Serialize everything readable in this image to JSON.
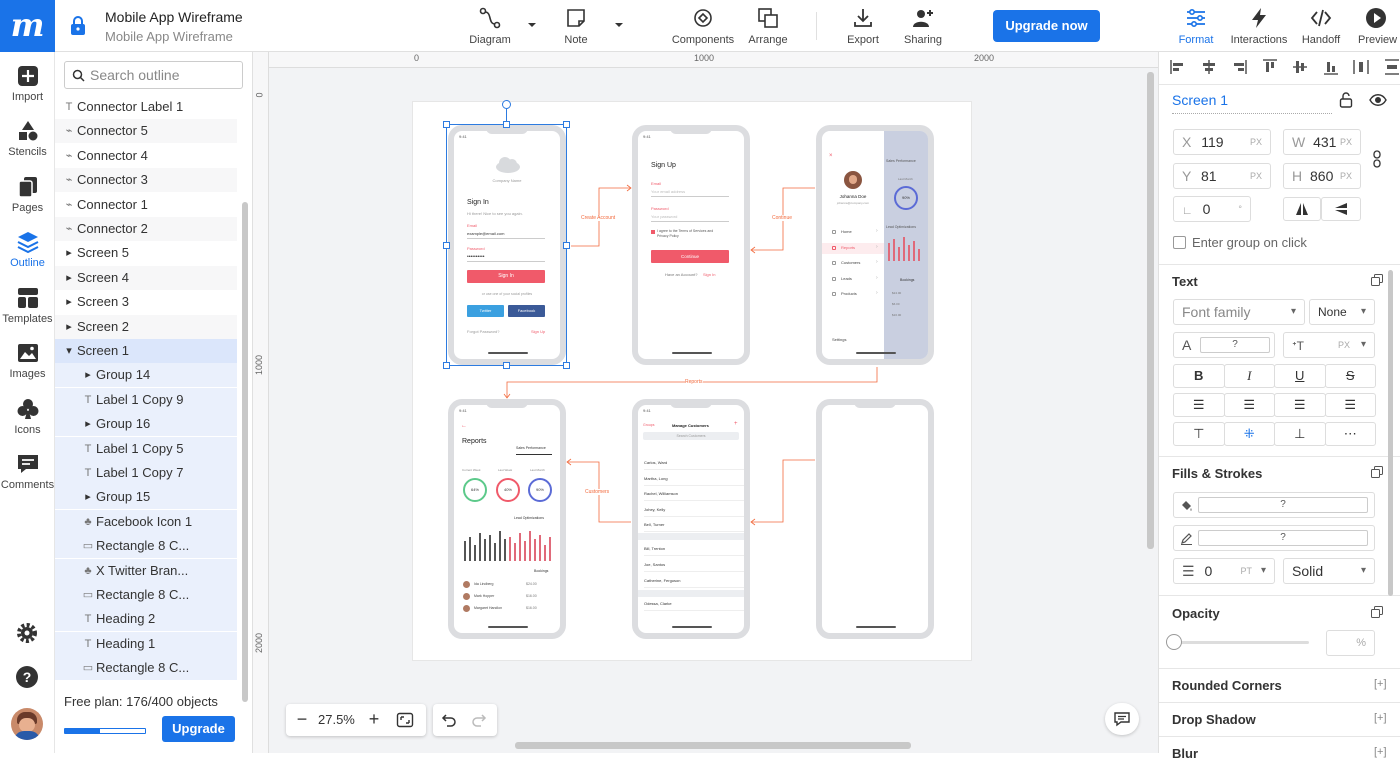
{
  "app": {
    "logo": "m",
    "title": "Mobile App Wireframe",
    "subtitle": "Mobile App Wireframe"
  },
  "toolbar": {
    "diagram": "Diagram",
    "note": "Note",
    "components": "Components",
    "arrange": "Arrange",
    "export": "Export",
    "sharing": "Sharing",
    "upgrade_now": "Upgrade now",
    "format": "Format",
    "interactions": "Interactions",
    "handoff": "Handoff",
    "preview": "Preview"
  },
  "leftrail": {
    "import": "Import",
    "stencils": "Stencils",
    "pages": "Pages",
    "outline": "Outline",
    "templates": "Templates",
    "images": "Images",
    "icons": "Icons",
    "comments": "Comments"
  },
  "outline": {
    "search_placeholder": "Search outline",
    "items": [
      {
        "label": "Connector Label 1",
        "icon": "text-icon"
      },
      {
        "label": "Connector 5",
        "icon": "connector-icon"
      },
      {
        "label": "Connector 4",
        "icon": "connector-icon"
      },
      {
        "label": "Connector 3",
        "icon": "connector-icon"
      },
      {
        "label": "Connector 1",
        "icon": "connector-icon"
      },
      {
        "label": "Connector 2",
        "icon": "connector-icon"
      },
      {
        "label": "Screen 5",
        "icon": "caret-right-icon"
      },
      {
        "label": "Screen 4",
        "icon": "caret-right-icon"
      },
      {
        "label": "Screen 3",
        "icon": "caret-right-icon"
      },
      {
        "label": "Screen 2",
        "icon": "caret-right-icon"
      },
      {
        "label": "Screen 1",
        "icon": "caret-down-icon"
      },
      {
        "label": "Group 14",
        "icon": "caret-right-icon"
      },
      {
        "label": "Label 1 Copy 9",
        "icon": "text-icon"
      },
      {
        "label": "Group 16",
        "icon": "caret-right-icon"
      },
      {
        "label": "Label 1 Copy 5",
        "icon": "text-icon"
      },
      {
        "label": "Label 1 Copy 7",
        "icon": "text-icon"
      },
      {
        "label": "Group 15",
        "icon": "caret-right-icon"
      },
      {
        "label": "Facebook Icon 1",
        "icon": "club-icon"
      },
      {
        "label": "Rectangle 8 C...",
        "icon": "rectangle-icon"
      },
      {
        "label": "X Twitter Bran...",
        "icon": "club-icon"
      },
      {
        "label": "Rectangle 8 C...",
        "icon": "rectangle-icon"
      },
      {
        "label": "Heading 2",
        "icon": "text-icon"
      },
      {
        "label": "Heading 1",
        "icon": "text-icon"
      },
      {
        "label": "Rectangle 8 C...",
        "icon": "rectangle-icon"
      }
    ],
    "plan_text": "Free plan: 176/400 objects",
    "plan_progress": 0.44,
    "upgrade": "Upgrade"
  },
  "rulers": {
    "top": [
      "0",
      "1000",
      "2000"
    ],
    "left": [
      "0",
      "1000",
      "2000"
    ]
  },
  "screens": {
    "s1": {
      "time": "9:41",
      "company": "Company Name",
      "signin": "Sign In",
      "hi": "Hi there! Nice to see you again.",
      "email_label": "Email",
      "email_value": "example@email.com",
      "password_label": "Password",
      "password_value": "••••••••••",
      "signin_btn": "Sign In",
      "or": "or use one of your social profiles",
      "twitter": "Twitter",
      "facebook": "Facebook",
      "forgot": "Forgot Password?",
      "signup": "Sign Up"
    },
    "s2": {
      "time": "9:41",
      "title": "Sign Up",
      "email_label": "Email",
      "email_ph": "Your email address",
      "password_label": "Password",
      "password_ph": "Your password",
      "agree": "I agree to the Terms of Services and Privacy Policy",
      "continue": "Continue",
      "have": "Have an Account?",
      "signin": "Sign In"
    },
    "s3": {
      "time": "9:41",
      "name": "Johanna Doe",
      "email": "johanna@company.com",
      "menu": [
        "Home",
        "Reports",
        "Customers",
        "Leads",
        "Products"
      ],
      "settings": "Settings",
      "sales": "Sales Performance",
      "last_month": "Last Month",
      "pct": "90%",
      "lead": "Lead Optimizations",
      "bookings": "Bookings",
      "amounts": [
        "$24.00",
        "$6.00",
        "$16.00"
      ]
    },
    "s4": {
      "time": "9:41",
      "title": "Reports",
      "sales": "Sales Performance",
      "labels": [
        "Current Week",
        "Last Week",
        "Last Month"
      ],
      "pcts": [
        "64%",
        "40%",
        "90%"
      ],
      "lead": "Lead Optimizations",
      "bookings": "Bookings",
      "people": [
        {
          "name": "Ida Lindberg",
          "amt": "$24.00"
        },
        {
          "name": "Mark Hopper",
          "amt": "$16.00"
        },
        {
          "name": "Margaret Handlon",
          "amt": "$16.00"
        }
      ]
    },
    "s5": {
      "time": "9:41",
      "groups": "Groups",
      "title": "Manage Customers",
      "search": "Search Customers",
      "names": [
        "Carlos, Ward",
        "Martha, Long",
        "Rachel, Williamson",
        "Johey, Kelly",
        "Bell, Turner",
        "Bill, Trenton",
        "Joe, Santos",
        "Catherine, Ferguson",
        "Odessa, Clarke"
      ]
    }
  },
  "connectors": {
    "create": "Create Account",
    "continue": "Continue",
    "reports": "Reports",
    "customers": "Customers"
  },
  "zoom": {
    "level": "27.5%"
  },
  "format": {
    "element_name": "Screen 1",
    "x": "119",
    "y": "81",
    "w": "431",
    "h": "860",
    "angle": "0",
    "unit": "PX",
    "enter_group": "Enter group on click",
    "text_title": "Text",
    "font_family": "Font family",
    "font_style": "None",
    "q": "?",
    "fills_title": "Fills & Strokes",
    "stroke_width": "0",
    "stroke_unit": "PT",
    "stroke_style": "Solid",
    "opacity_title": "Opacity",
    "opacity_unit": "%",
    "rounded": "Rounded Corners",
    "shadow": "Drop Shadow",
    "blur": "Blur",
    "plus": "[+]"
  },
  "colors": {
    "brand": "#1a73e8",
    "accent": "#f26a3d",
    "pink": "#f05a6a"
  }
}
